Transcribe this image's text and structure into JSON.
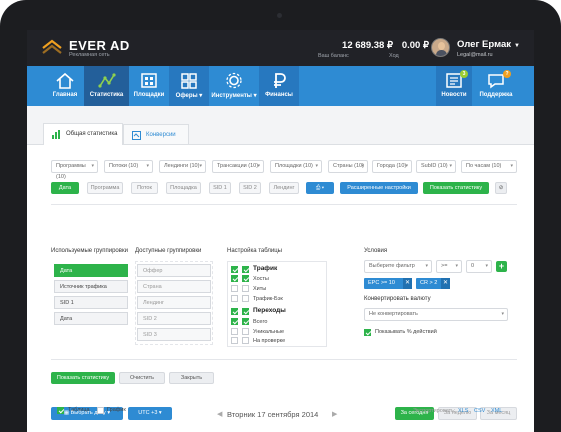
{
  "brand": {
    "name": "EVER AD",
    "subtitle": "Рекламная сеть"
  },
  "header": {
    "balance": {
      "value": "12 689.38 ₽",
      "label": "Ваш баланс"
    },
    "income": {
      "value": "0.00 ₽",
      "label": "Ход"
    },
    "user": {
      "name": "Олег Ермак",
      "email": "Legal@mail.ru"
    }
  },
  "nav": {
    "items": [
      {
        "label": "Главная",
        "icon": "home-icon"
      },
      {
        "label": "Статистика",
        "icon": "statistics-icon"
      },
      {
        "label": "Площадки",
        "icon": "sites-icon"
      },
      {
        "label": "Оферы",
        "icon": "offers-icon"
      },
      {
        "label": "Инструменты",
        "icon": "tools-icon"
      },
      {
        "label": "Финансы",
        "icon": "finance-icon"
      }
    ],
    "right": [
      {
        "label": "Новости",
        "icon": "news-icon",
        "badge": "3"
      },
      {
        "label": "Поддержка",
        "icon": "support-icon",
        "badge": "?"
      }
    ]
  },
  "tabs": [
    {
      "label": "Общая статистика"
    },
    {
      "label": "Конверсии"
    }
  ],
  "filters": {
    "dropdowns": [
      "Программы (10)",
      "Потоки (10)",
      "Лендинги (10)",
      "Трансакции (10)",
      "Площадки (10)",
      "Страны (10)",
      "Города (10)",
      "SubID (10)",
      "По часам (10)"
    ],
    "pills": [
      "Дата",
      "Программа",
      "Поток",
      "Площадка",
      "SID 1",
      "SID 2",
      "Лендинг"
    ],
    "advanced_label": "Расширенные настройки",
    "show_label": "Показать статистику"
  },
  "groupings": {
    "used_title": "Используемые группировки",
    "used": [
      "Дата",
      "Источник трафика",
      "SID 1",
      "Дата"
    ],
    "available_title": "Доступные группировки",
    "available": [
      "Оффер",
      "Страна",
      "Лендинг",
      "SID 2",
      "SID 3"
    ]
  },
  "table_settings": {
    "title": "Настройка таблицы",
    "traffic_title": "Трафик",
    "traffic": [
      "Хосты",
      "Хиты",
      "Трафик-Бэк"
    ],
    "clicks_title": "Переходы",
    "clicks": [
      "Всего",
      "Уникальные",
      "На проверке"
    ]
  },
  "conditions": {
    "title": "Условия",
    "filter_placeholder": "Выберите фильтр",
    "operator": ">=",
    "value": "0",
    "tags": [
      "EPC >= 10",
      "CR > 2"
    ],
    "currency_title": "Конвертировать валюту",
    "currency_value": "Не конвертировать",
    "show_percent": "Показывать % действий"
  },
  "actions": {
    "show": "Показать статистику",
    "clear": "Очистить",
    "close": "Закрыть"
  },
  "datebar": {
    "pick_date": "Выбрать дату",
    "timezone": "UTC +3",
    "current_date": "Вторник 17 сентября 2014",
    "today": "За сегодня",
    "week": "За неделю",
    "month": "За месяц"
  },
  "view": {
    "table": "Таблица",
    "graph": "График",
    "export_label": "Экспортировать:",
    "formats": [
      "XLS",
      "CSV",
      "XML"
    ]
  },
  "colors": {
    "accent": "#2e8bd3",
    "green": "#2db34a",
    "dark": "#212227",
    "nav_active": "#235f9a"
  }
}
